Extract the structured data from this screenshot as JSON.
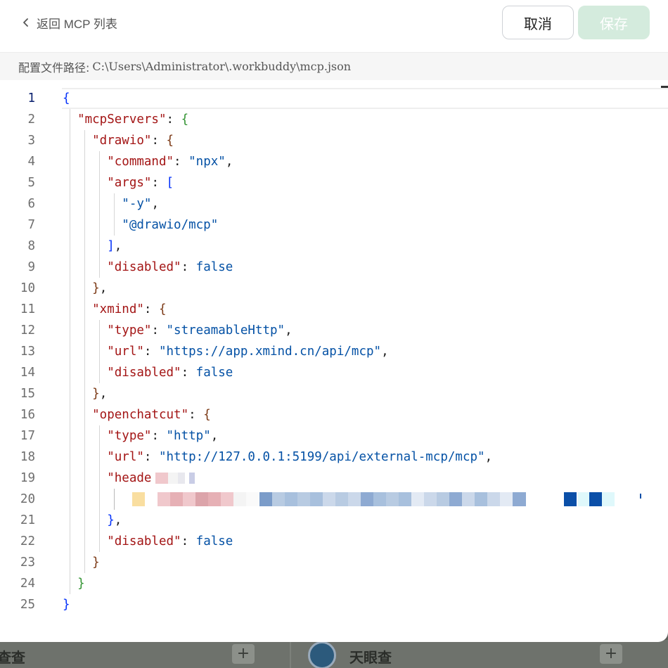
{
  "header": {
    "back_label": "返回 MCP 列表",
    "cancel_label": "取消",
    "save_label": "保存"
  },
  "path": {
    "label": "配置文件路径:",
    "value": "C:\\Users\\Administrator\\.workbuddy\\mcp.json"
  },
  "editor": {
    "active_line": 1,
    "line_numbers": [
      "1",
      "2",
      "3",
      "4",
      "5",
      "6",
      "7",
      "8",
      "9",
      "10",
      "11",
      "12",
      "13",
      "14",
      "15",
      "16",
      "17",
      "18",
      "19",
      "20",
      "21",
      "22",
      "23",
      "24",
      "25"
    ],
    "lines": [
      [
        [
          "b1",
          "{"
        ]
      ],
      [
        [
          "k",
          "  \"mcpServers\""
        ],
        [
          "p",
          ": "
        ],
        [
          "b2",
          "{"
        ]
      ],
      [
        [
          "k",
          "    \"drawio\""
        ],
        [
          "p",
          ": "
        ],
        [
          "b3",
          "{"
        ]
      ],
      [
        [
          "k",
          "      \"command\""
        ],
        [
          "p",
          ": "
        ],
        [
          "s",
          "\"npx\""
        ],
        [
          "p",
          ","
        ]
      ],
      [
        [
          "k",
          "      \"args\""
        ],
        [
          "p",
          ": "
        ],
        [
          "b1",
          "["
        ]
      ],
      [
        [
          "s",
          "        \"-y\""
        ],
        [
          "p",
          ","
        ]
      ],
      [
        [
          "s",
          "        \"@drawio/mcp\""
        ]
      ],
      [
        [
          "b1",
          "      ]"
        ],
        [
          "p",
          ","
        ]
      ],
      [
        [
          "k",
          "      \"disabled\""
        ],
        [
          "p",
          ": "
        ],
        [
          "kw",
          "false"
        ]
      ],
      [
        [
          "b3",
          "    }"
        ],
        [
          "p",
          ","
        ]
      ],
      [
        [
          "k",
          "    \"xmind\""
        ],
        [
          "p",
          ": "
        ],
        [
          "b3",
          "{"
        ]
      ],
      [
        [
          "k",
          "      \"type\""
        ],
        [
          "p",
          ": "
        ],
        [
          "s",
          "\"streamableHttp\""
        ],
        [
          "p",
          ","
        ]
      ],
      [
        [
          "k",
          "      \"url\""
        ],
        [
          "p",
          ": "
        ],
        [
          "s",
          "\"https://app.xmind.cn/api/mcp\""
        ],
        [
          "p",
          ","
        ]
      ],
      [
        [
          "k",
          "      \"disabled\""
        ],
        [
          "p",
          ": "
        ],
        [
          "kw",
          "false"
        ]
      ],
      [
        [
          "b3",
          "    }"
        ],
        [
          "p",
          ","
        ]
      ],
      [
        [
          "k",
          "    \"openchatcut\""
        ],
        [
          "p",
          ": "
        ],
        [
          "b3",
          "{"
        ]
      ],
      [
        [
          "k",
          "      \"type\""
        ],
        [
          "p",
          ": "
        ],
        [
          "s",
          "\"http\""
        ],
        [
          "p",
          ","
        ]
      ],
      [
        [
          "k",
          "      \"url\""
        ],
        [
          "p",
          ": "
        ],
        [
          "s",
          "\"http://127.0.0.1:5199/api/external-mcp/mcp\""
        ],
        [
          "p",
          ","
        ]
      ],
      [
        [
          "k",
          "      \"heade"
        ]
      ],
      [
        [
          "p",
          ""
        ]
      ],
      [
        [
          "b1",
          "      }"
        ],
        [
          "p",
          ","
        ]
      ],
      [
        [
          "k",
          "      \"disabled\""
        ],
        [
          "p",
          ": "
        ],
        [
          "kw",
          "false"
        ]
      ],
      [
        [
          "b3",
          "    }"
        ]
      ],
      [
        [
          "b2",
          "  }"
        ]
      ],
      [
        [
          "b1",
          "}"
        ]
      ]
    ]
  },
  "redaction_colors": [
    "#f9dea0",
    "#f0c8cc",
    "#e6b0b5",
    "#dca4aa",
    "#f4f4f4",
    "#7b9cc9",
    "#b8cbe2",
    "#a8c0dd",
    "#cbd8ea",
    "#8eaad2",
    "#e3eaf4",
    "#0b4fa8",
    "#dff8fb"
  ],
  "background_app": {
    "left_text": "查查",
    "brand": "天眼查",
    "plus": "+"
  }
}
